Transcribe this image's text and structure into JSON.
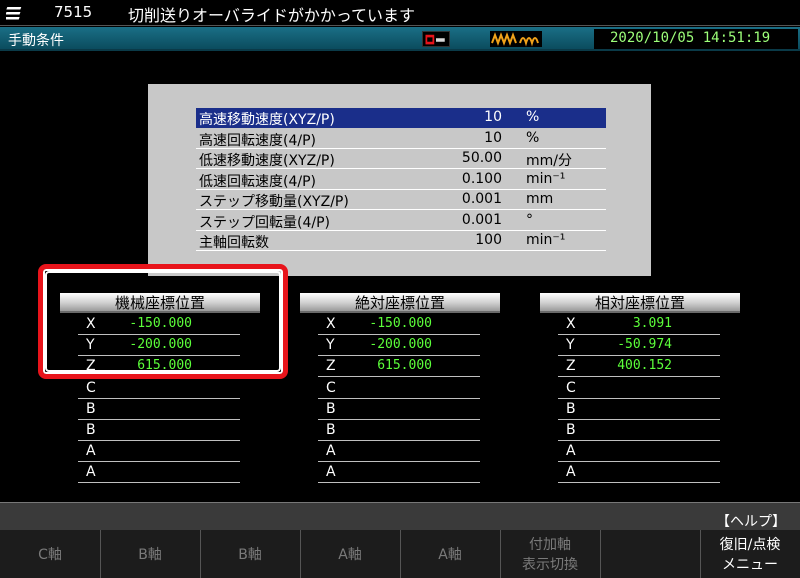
{
  "titlebar": {
    "number": "7515",
    "message": "切削送りオーバライドがかかっています"
  },
  "statusbar": {
    "mode": "手動条件",
    "clock": "2020/10/05 14:51:19"
  },
  "settings": [
    {
      "label": "高速移動速度(XYZ/P)",
      "value": "10",
      "unit": "%"
    },
    {
      "label": "高速回転速度(4/P)",
      "value": "10",
      "unit": "%"
    },
    {
      "label": "低速移動速度(XYZ/P)",
      "value": "50.00",
      "unit": "mm/分"
    },
    {
      "label": "低速回転速度(4/P)",
      "value": "0.100",
      "unit": "min⁻¹"
    },
    {
      "label": "ステップ移動量(XYZ/P)",
      "value": "0.001",
      "unit": "mm"
    },
    {
      "label": "ステップ回転量(4/P)",
      "value": "0.001",
      "unit": "°"
    },
    {
      "label": "主軸回転数",
      "value": "100",
      "unit": "min⁻¹"
    }
  ],
  "columns": [
    {
      "title": "機械座標位置",
      "rows": [
        {
          "axis": "X",
          "value": "-150.000"
        },
        {
          "axis": "Y",
          "value": "-200.000"
        },
        {
          "axis": "Z",
          "value": "615.000"
        },
        {
          "axis": "C",
          "value": ""
        },
        {
          "axis": "B",
          "value": ""
        },
        {
          "axis": "B",
          "value": ""
        },
        {
          "axis": "A",
          "value": ""
        },
        {
          "axis": "A",
          "value": ""
        }
      ]
    },
    {
      "title": "絶対座標位置",
      "rows": [
        {
          "axis": "X",
          "value": "-150.000"
        },
        {
          "axis": "Y",
          "value": "-200.000"
        },
        {
          "axis": "Z",
          "value": "615.000"
        },
        {
          "axis": "C",
          "value": ""
        },
        {
          "axis": "B",
          "value": ""
        },
        {
          "axis": "B",
          "value": ""
        },
        {
          "axis": "A",
          "value": ""
        },
        {
          "axis": "A",
          "value": ""
        }
      ]
    },
    {
      "title": "相対座標位置",
      "rows": [
        {
          "axis": "X",
          "value": "3.091"
        },
        {
          "axis": "Y",
          "value": "-50.974"
        },
        {
          "axis": "Z",
          "value": "400.152"
        },
        {
          "axis": "C",
          "value": ""
        },
        {
          "axis": "B",
          "value": ""
        },
        {
          "axis": "B",
          "value": ""
        },
        {
          "axis": "A",
          "value": ""
        },
        {
          "axis": "A",
          "value": ""
        }
      ]
    }
  ],
  "help": "【ヘルプ】",
  "softkeys": [
    {
      "label": "C軸",
      "enabled": false
    },
    {
      "label": "B軸",
      "enabled": false
    },
    {
      "label": "B軸",
      "enabled": false
    },
    {
      "label": "A軸",
      "enabled": false
    },
    {
      "label": "A軸",
      "enabled": false
    },
    {
      "label": "付加軸\n表示切換",
      "enabled": false
    },
    {
      "label": "",
      "enabled": false
    },
    {
      "label": "復旧/点検\nメニュー",
      "enabled": true
    }
  ],
  "colors": {
    "accent_teal": "#1a6f86",
    "selected_row": "#1a2e8a",
    "value_green": "#5cff3a",
    "highlight_red": "#e8141b"
  }
}
